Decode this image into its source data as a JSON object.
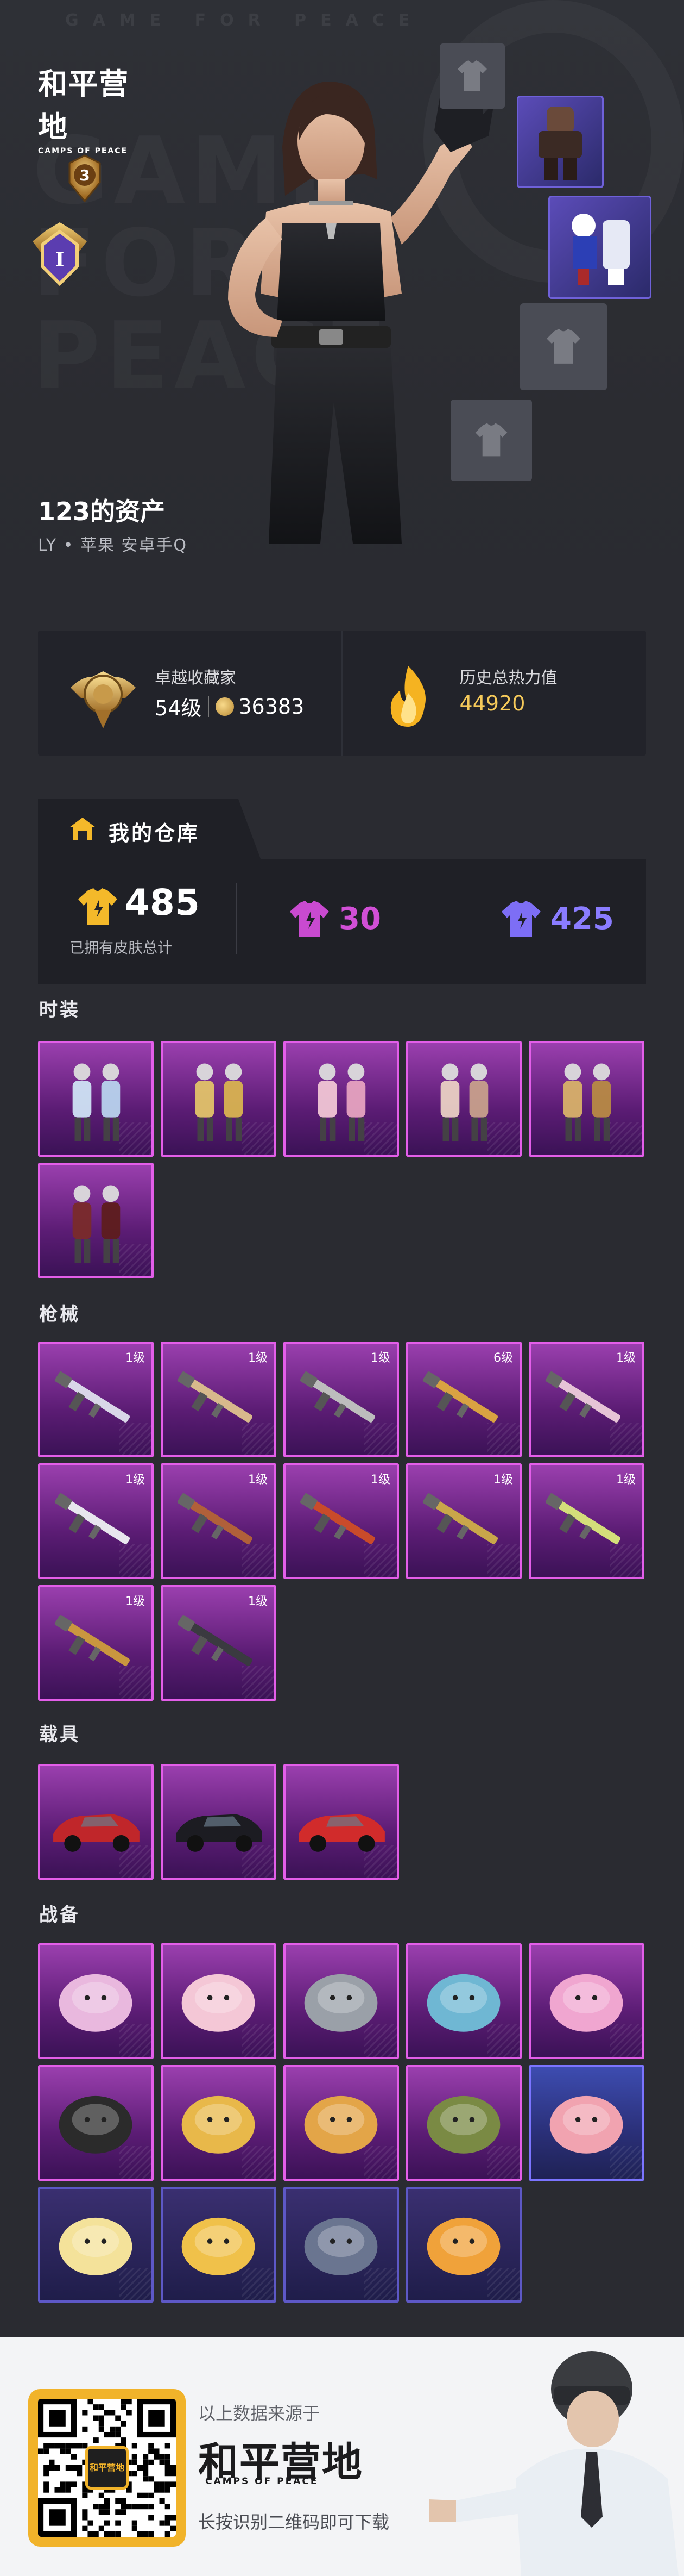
{
  "hero": {
    "watermark": "GAME FOR PEACE",
    "big_text": "GAME FOR PEACE",
    "logo": "和平营地",
    "logo_sub": "CAMPS OF PEACE",
    "season_badge": "3",
    "rank_badge": "I",
    "player_name": "123的资产",
    "player_sub": "LY • 苹果  安卓手Q"
  },
  "stats": [
    {
      "label": "卓越收藏家",
      "level": "54级",
      "coins": "36383",
      "icon": "collector-medal-icon"
    },
    {
      "label": "历史总热力值",
      "value": "44920",
      "icon": "flame-icon"
    }
  ],
  "warehouse": {
    "title": "我的仓库",
    "total": "485",
    "total_label": "已拥有皮肤总计",
    "purple_count": "30",
    "blue_count": "425"
  },
  "categories": {
    "fashion": {
      "title": "时装",
      "items": [
        {
          "name": "outfit-1",
          "tier": "purple"
        },
        {
          "name": "outfit-2",
          "tier": "purple"
        },
        {
          "name": "outfit-3",
          "tier": "purple"
        },
        {
          "name": "outfit-4",
          "tier": "purple"
        },
        {
          "name": "outfit-5",
          "tier": "purple"
        },
        {
          "name": "outfit-6",
          "tier": "purple"
        }
      ]
    },
    "weapons": {
      "title": "枪械",
      "items": [
        {
          "level": "1级",
          "tier": "purple"
        },
        {
          "level": "1级",
          "tier": "purple"
        },
        {
          "level": "1级",
          "tier": "purple"
        },
        {
          "level": "6级",
          "tier": "purple"
        },
        {
          "level": "1级",
          "tier": "purple"
        },
        {
          "level": "1级",
          "tier": "purple"
        },
        {
          "level": "1级",
          "tier": "purple"
        },
        {
          "level": "1级",
          "tier": "purple"
        },
        {
          "level": "1级",
          "tier": "purple"
        },
        {
          "level": "1级",
          "tier": "purple"
        },
        {
          "level": "1级",
          "tier": "purple"
        },
        {
          "level": "1级",
          "tier": "purple"
        }
      ]
    },
    "vehicles": {
      "title": "载具",
      "items": [
        {
          "tier": "purple"
        },
        {
          "tier": "purple"
        },
        {
          "tier": "purple"
        }
      ]
    },
    "gear": {
      "title": "战备",
      "items": [
        {
          "tier": "purple"
        },
        {
          "tier": "purple"
        },
        {
          "tier": "purple"
        },
        {
          "tier": "purple"
        },
        {
          "tier": "purple"
        },
        {
          "tier": "purple"
        },
        {
          "tier": "purple"
        },
        {
          "tier": "purple"
        },
        {
          "tier": "purple"
        },
        {
          "tier": "blue"
        },
        {
          "tier": "dark"
        },
        {
          "tier": "dark"
        },
        {
          "tier": "dark"
        },
        {
          "tier": "dark"
        }
      ]
    }
  },
  "footer": {
    "line1": "以上数据来源于",
    "logo": "和平营地",
    "logo_sub": "CAMPS OF PEACE",
    "line2": "长按识别二维码即可下载",
    "qr_logo": "和平营地"
  },
  "colors": {
    "purple_border": "#e35ee9",
    "blue_border": "#7b74ff",
    "gold": "#f5c95a",
    "background": "#2a2b31"
  }
}
